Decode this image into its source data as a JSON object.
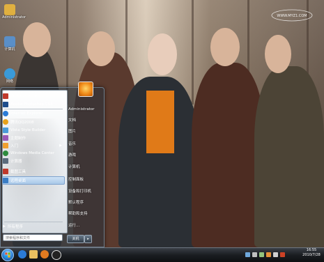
{
  "watermark": {
    "text": "WWW.MYZ1.COM"
  },
  "start_menu": {
    "programs": [
      {
        "label": "Restorator.exe",
        "icon": "restorator-icon",
        "color": "#c0392b"
      },
      {
        "label": "Adobe Photoshop CS3",
        "icon": "photoshop-icon",
        "color": "#1f4e8c"
      },
      {
        "label": "Internet Explorer",
        "icon": "ie-icon",
        "color": "#2b7bd6"
      },
      {
        "label": "腾讯QQ2008",
        "icon": "qq-icon",
        "color": "#e8a21a"
      },
      {
        "label": "Vista Style Builder",
        "icon": "vsb-icon",
        "color": "#4a9bd8"
      },
      {
        "label": "主题制作",
        "icon": "theme-icon",
        "color": "#9b59b6"
      },
      {
        "label": "入门",
        "icon": "getting-started-icon",
        "color": "#f0a030"
      },
      {
        "label": "Windows Media Center",
        "icon": "media-center-icon",
        "color": "#2e8b3d"
      },
      {
        "label": "计算器",
        "icon": "calculator-icon",
        "color": "#5a6b7c"
      },
      {
        "label": "截图工具",
        "icon": "snipping-tool-icon",
        "color": "#c0392b"
      },
      {
        "label": "远程桌面",
        "icon": "remote-desktop-icon",
        "color": "#3b7dc4"
      }
    ],
    "all_programs": "所有程序",
    "search_placeholder": "搜索程序和文件",
    "user": "Administrator",
    "right_items": [
      "文档",
      "图片",
      "音乐",
      "游戏",
      "计算机",
      "控制面板",
      "设备和打印机",
      "默认程序",
      "帮助和支持",
      "运行..."
    ],
    "shutdown": "关机"
  },
  "desktop_icons": [
    {
      "label": "Administrator",
      "icon": "user-folder-icon",
      "color": "#e0b040"
    },
    {
      "label": "计算机",
      "icon": "computer-icon",
      "color": "#5a8fc8"
    },
    {
      "label": "网络",
      "icon": "network-icon",
      "color": "#3a9ad8"
    }
  ],
  "taskbar": {
    "quick_launch": [
      {
        "icon": "ie-icon",
        "color": "#2b7bd6"
      },
      {
        "icon": "explorer-icon",
        "color": "#e8c060"
      },
      {
        "icon": "media-player-icon",
        "color": "#e07a20"
      },
      {
        "icon": "qq-icon",
        "color": "#222222"
      }
    ],
    "tray": [
      "tray-icon-1",
      "tray-icon-2",
      "tray-icon-3",
      "tray-icon-4",
      "tray-icon-5",
      "tray-icon-6"
    ],
    "time": "16:55",
    "date": "2010/7/28"
  }
}
